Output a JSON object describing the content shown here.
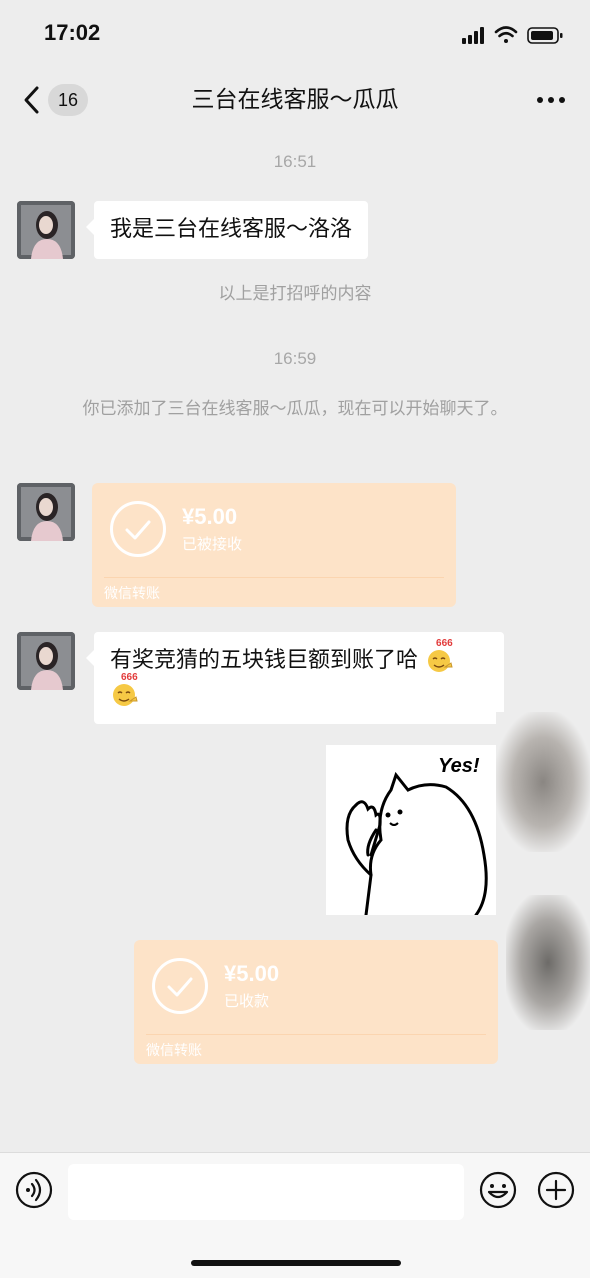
{
  "status_bar": {
    "time": "17:02"
  },
  "nav": {
    "back_count": "16",
    "title": "三台在线客服～瓜瓜"
  },
  "messages": {
    "time1": "16:51",
    "greeting": "我是三台在线客服～洛洛",
    "greeting_note": "以上是打招呼的内容",
    "time2": "16:59",
    "added_notice": "你已添加了三台在线客服～瓜瓜，现在可以开始聊天了。",
    "guess_text": "有奖竞猜的五块钱巨额到账了哈"
  },
  "transfers": [
    {
      "amount": "¥5.00",
      "status": "已被接收",
      "footer": "微信转账"
    },
    {
      "amount": "¥5.00",
      "status": "已收款",
      "footer": "微信转账"
    }
  ],
  "sticker": {
    "text": "Yes!"
  },
  "emoji": {
    "label": "666"
  },
  "icons": {
    "back": "chevron-left-icon",
    "more": "more-dots-icon",
    "voice": "voice-icon",
    "emoji": "emoji-face-icon",
    "plus": "plus-icon"
  }
}
